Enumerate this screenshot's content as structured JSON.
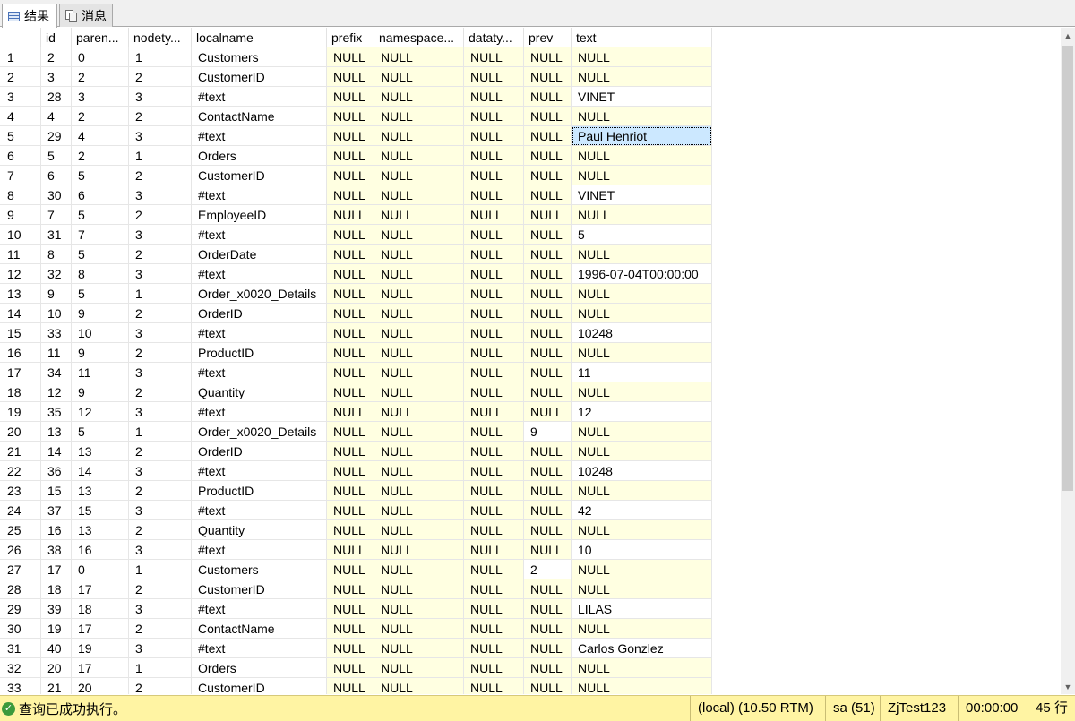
{
  "tabs": {
    "results": "结果",
    "messages": "消息"
  },
  "columns": [
    "",
    "id",
    "paren...",
    "nodety...",
    "localname",
    "prefix",
    "namespace...",
    "dataty...",
    "prev",
    "text"
  ],
  "rows": [
    [
      "1",
      "2",
      "0",
      "1",
      "Customers",
      "NULL",
      "NULL",
      "NULL",
      "NULL",
      "NULL"
    ],
    [
      "2",
      "3",
      "2",
      "2",
      "CustomerID",
      "NULL",
      "NULL",
      "NULL",
      "NULL",
      "NULL"
    ],
    [
      "3",
      "28",
      "3",
      "3",
      "#text",
      "NULL",
      "NULL",
      "NULL",
      "NULL",
      "VINET"
    ],
    [
      "4",
      "4",
      "2",
      "2",
      "ContactName",
      "NULL",
      "NULL",
      "NULL",
      "NULL",
      "NULL"
    ],
    [
      "5",
      "29",
      "4",
      "3",
      "#text",
      "NULL",
      "NULL",
      "NULL",
      "NULL",
      "Paul Henriot"
    ],
    [
      "6",
      "5",
      "2",
      "1",
      "Orders",
      "NULL",
      "NULL",
      "NULL",
      "NULL",
      "NULL"
    ],
    [
      "7",
      "6",
      "5",
      "2",
      "CustomerID",
      "NULL",
      "NULL",
      "NULL",
      "NULL",
      "NULL"
    ],
    [
      "8",
      "30",
      "6",
      "3",
      "#text",
      "NULL",
      "NULL",
      "NULL",
      "NULL",
      "VINET"
    ],
    [
      "9",
      "7",
      "5",
      "2",
      "EmployeeID",
      "NULL",
      "NULL",
      "NULL",
      "NULL",
      "NULL"
    ],
    [
      "10",
      "31",
      "7",
      "3",
      "#text",
      "NULL",
      "NULL",
      "NULL",
      "NULL",
      "5"
    ],
    [
      "11",
      "8",
      "5",
      "2",
      "OrderDate",
      "NULL",
      "NULL",
      "NULL",
      "NULL",
      "NULL"
    ],
    [
      "12",
      "32",
      "8",
      "3",
      "#text",
      "NULL",
      "NULL",
      "NULL",
      "NULL",
      "1996-07-04T00:00:00"
    ],
    [
      "13",
      "9",
      "5",
      "1",
      "Order_x0020_Details",
      "NULL",
      "NULL",
      "NULL",
      "NULL",
      "NULL"
    ],
    [
      "14",
      "10",
      "9",
      "2",
      "OrderID",
      "NULL",
      "NULL",
      "NULL",
      "NULL",
      "NULL"
    ],
    [
      "15",
      "33",
      "10",
      "3",
      "#text",
      "NULL",
      "NULL",
      "NULL",
      "NULL",
      "10248"
    ],
    [
      "16",
      "11",
      "9",
      "2",
      "ProductID",
      "NULL",
      "NULL",
      "NULL",
      "NULL",
      "NULL"
    ],
    [
      "17",
      "34",
      "11",
      "3",
      "#text",
      "NULL",
      "NULL",
      "NULL",
      "NULL",
      "11"
    ],
    [
      "18",
      "12",
      "9",
      "2",
      "Quantity",
      "NULL",
      "NULL",
      "NULL",
      "NULL",
      "NULL"
    ],
    [
      "19",
      "35",
      "12",
      "3",
      "#text",
      "NULL",
      "NULL",
      "NULL",
      "NULL",
      "12"
    ],
    [
      "20",
      "13",
      "5",
      "1",
      "Order_x0020_Details",
      "NULL",
      "NULL",
      "NULL",
      "9",
      "NULL"
    ],
    [
      "21",
      "14",
      "13",
      "2",
      "OrderID",
      "NULL",
      "NULL",
      "NULL",
      "NULL",
      "NULL"
    ],
    [
      "22",
      "36",
      "14",
      "3",
      "#text",
      "NULL",
      "NULL",
      "NULL",
      "NULL",
      "10248"
    ],
    [
      "23",
      "15",
      "13",
      "2",
      "ProductID",
      "NULL",
      "NULL",
      "NULL",
      "NULL",
      "NULL"
    ],
    [
      "24",
      "37",
      "15",
      "3",
      "#text",
      "NULL",
      "NULL",
      "NULL",
      "NULL",
      "42"
    ],
    [
      "25",
      "16",
      "13",
      "2",
      "Quantity",
      "NULL",
      "NULL",
      "NULL",
      "NULL",
      "NULL"
    ],
    [
      "26",
      "38",
      "16",
      "3",
      "#text",
      "NULL",
      "NULL",
      "NULL",
      "NULL",
      "10"
    ],
    [
      "27",
      "17",
      "0",
      "1",
      "Customers",
      "NULL",
      "NULL",
      "NULL",
      "2",
      "NULL"
    ],
    [
      "28",
      "18",
      "17",
      "2",
      "CustomerID",
      "NULL",
      "NULL",
      "NULL",
      "NULL",
      "NULL"
    ],
    [
      "29",
      "39",
      "18",
      "3",
      "#text",
      "NULL",
      "NULL",
      "NULL",
      "NULL",
      "LILAS"
    ],
    [
      "30",
      "19",
      "17",
      "2",
      "ContactName",
      "NULL",
      "NULL",
      "NULL",
      "NULL",
      "NULL"
    ],
    [
      "31",
      "40",
      "19",
      "3",
      "#text",
      "NULL",
      "NULL",
      "NULL",
      "NULL",
      "Carlos Gonzlez"
    ],
    [
      "32",
      "20",
      "17",
      "1",
      "Orders",
      "NULL",
      "NULL",
      "NULL",
      "NULL",
      "NULL"
    ],
    [
      "33",
      "21",
      "20",
      "2",
      "CustomerID",
      "NULL",
      "NULL",
      "NULL",
      "NULL",
      "NULL"
    ]
  ],
  "selected_cell": {
    "row": 5,
    "column": "text"
  },
  "status": {
    "message": "查询已成功执行。",
    "server": "(local) (10.50 RTM)",
    "user": "sa (51)",
    "database": "ZjTest123",
    "elapsed": "00:00:00",
    "row_count": "45 行"
  },
  "colors": {
    "null_cell": "#ffffe1",
    "selection": "#cce8ff",
    "status_bar": "#fff4a3"
  }
}
